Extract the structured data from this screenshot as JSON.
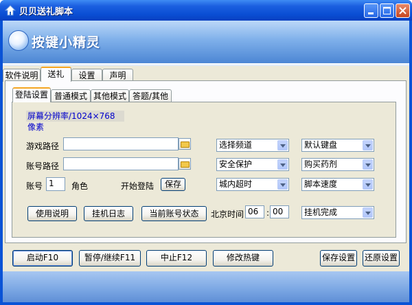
{
  "window": {
    "title": "贝贝送礼脚本"
  },
  "banner": {
    "logo_text": "按键小精灵"
  },
  "tabs_top": [
    {
      "label": "软件说明"
    },
    {
      "label": "送礼"
    },
    {
      "label": "设置"
    },
    {
      "label": "声明"
    }
  ],
  "tabs_inner": [
    {
      "label": "登陆设置"
    },
    {
      "label": "普通模式"
    },
    {
      "label": "其他模式"
    },
    {
      "label": "答题/其他"
    }
  ],
  "panel": {
    "resolution": "屏幕分辨率/1024×768 像素",
    "game_path_label": "游戏路径",
    "game_path_value": "",
    "account_path_label": "账号路径",
    "account_path_value": "",
    "account_label": "账号",
    "account_value": "1",
    "role_label": "角色",
    "start_login_label": "开始登陆",
    "save_small": "保存",
    "select_channel": "选择频道",
    "security": "安全保护",
    "timeout": "城内超时",
    "default_keyboard": "默认键盘",
    "buy_potion": "购买药剂",
    "script_speed": "脚本速度",
    "hang_complete": "挂机完成",
    "usage_btn": "使用说明",
    "log_btn": "挂机日志",
    "status_btn": "当前账号状态",
    "beijing_time_label": "北京时间",
    "hour": "06",
    "colon": ":",
    "minute": "00"
  },
  "footer": {
    "start": "启动F10",
    "pause": "暂停/继续F11",
    "stop": "中止F12",
    "hotkey": "修改热键",
    "save_settings": "保存设置",
    "restore": "还原设置"
  }
}
